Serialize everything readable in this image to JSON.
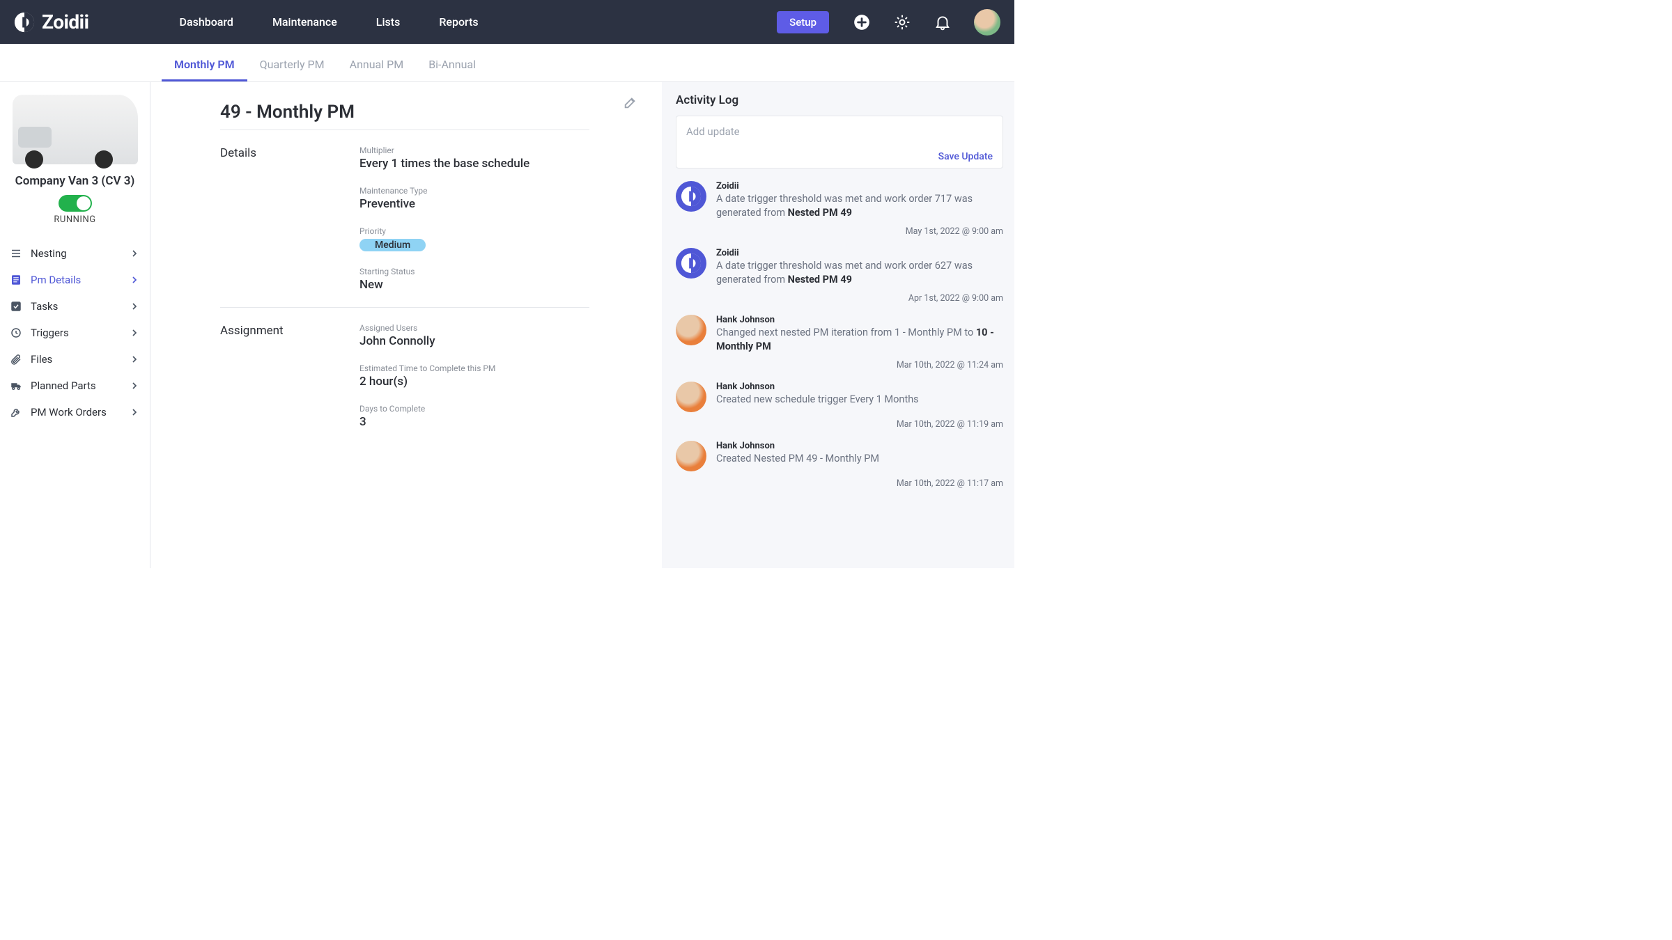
{
  "brand": "Zoidii",
  "nav": [
    "Dashboard",
    "Maintenance",
    "Lists",
    "Reports"
  ],
  "setup_label": "Setup",
  "tabs": [
    {
      "label": "Monthly PM",
      "active": true
    },
    {
      "label": "Quarterly PM",
      "active": false
    },
    {
      "label": "Annual PM",
      "active": false
    },
    {
      "label": "Bi-Annual",
      "active": false
    }
  ],
  "asset": {
    "name": "Company Van 3 (CV 3)",
    "status_label": "RUNNING"
  },
  "menu": [
    {
      "icon": "list",
      "label": "Nesting"
    },
    {
      "icon": "doc",
      "label": "Pm Details",
      "active": true
    },
    {
      "icon": "check",
      "label": "Tasks"
    },
    {
      "icon": "clock",
      "label": "Triggers"
    },
    {
      "icon": "clip",
      "label": "Files"
    },
    {
      "icon": "truck",
      "label": "Planned Parts"
    },
    {
      "icon": "wrench",
      "label": "PM Work Orders"
    }
  ],
  "page": {
    "title": "49 - Monthly PM",
    "details_heading": "Details",
    "assignment_heading": "Assignment",
    "fields": {
      "multiplier_label": "Multiplier",
      "multiplier_value": "Every 1 times the base schedule",
      "mtype_label": "Maintenance Type",
      "mtype_value": "Preventive",
      "priority_label": "Priority",
      "priority_value": "Medium",
      "status_label": "Starting Status",
      "status_value": "New",
      "assigned_label": "Assigned Users",
      "assigned_value": "John Connolly",
      "time_label": "Estimated Time to Complete this PM",
      "time_value": "2 hour(s)",
      "days_label": "Days to Complete",
      "days_value": "3"
    }
  },
  "activity": {
    "title": "Activity Log",
    "placeholder": "Add update",
    "save_label": "Save Update",
    "items": [
      {
        "author": "Zoidii",
        "avatar": "zoidii",
        "text_pre": "A date trigger threshold was met and work order 717 was generated from ",
        "text_bold": "Nested PM 49",
        "text_post": "",
        "time": "May 1st, 2022 @ 9:00 am"
      },
      {
        "author": "Zoidii",
        "avatar": "zoidii",
        "text_pre": "A date trigger threshold was met and work order 627 was generated from ",
        "text_bold": "Nested PM 49",
        "text_post": "",
        "time": "Apr 1st, 2022 @ 9:00 am"
      },
      {
        "author": "Hank Johnson",
        "avatar": "human",
        "text_pre": "Changed next nested PM iteration from 1 - Monthly PM to ",
        "text_bold": "10 - Monthly PM",
        "text_post": "",
        "time": "Mar 10th, 2022 @ 11:24 am"
      },
      {
        "author": "Hank Johnson",
        "avatar": "human",
        "text_pre": "Created new schedule trigger Every 1 Months",
        "text_bold": "",
        "text_post": "",
        "time": "Mar 10th, 2022 @ 11:19 am"
      },
      {
        "author": "Hank Johnson",
        "avatar": "human",
        "text_pre": "Created Nested PM 49 - Monthly PM",
        "text_bold": "",
        "text_post": "",
        "time": "Mar 10th, 2022 @ 11:17 am"
      }
    ]
  }
}
